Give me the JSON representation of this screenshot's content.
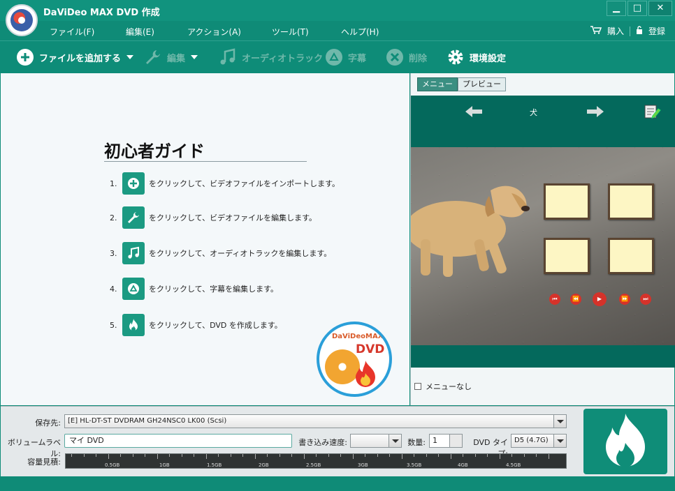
{
  "window": {
    "title": "DaViDeo MAX DVD 作成",
    "minimize": "▁",
    "maximize": "□",
    "close": "✕"
  },
  "menu": {
    "items": [
      "ファイル(F)",
      "編集(E)",
      "アクション(A)",
      "ツール(T)",
      "ヘルプ(H)"
    ],
    "buy": "購入",
    "register": "登録"
  },
  "toolbar": {
    "add_file": "ファイルを追加する",
    "edit": "編集",
    "audio_track": "オーディオトラック",
    "subtitle": "字幕",
    "delete": "削除",
    "settings": "環境設定"
  },
  "guide": {
    "title": "初心者ガイド",
    "steps": [
      {
        "num": "1.",
        "icon": "plus-icon",
        "text": "をクリックして、ビデオファイルをインポートします。"
      },
      {
        "num": "2.",
        "icon": "wrench-icon",
        "text": "をクリックして、ビデオファイルを編集します。"
      },
      {
        "num": "3.",
        "icon": "music-note-icon",
        "text": "をクリックして、オーディオトラックを編集します。"
      },
      {
        "num": "4.",
        "icon": "subtitle-icon",
        "text": "をクリックして、字幕を編集します。"
      },
      {
        "num": "5.",
        "icon": "flame-icon",
        "text": "をクリックして、DVD を作成します。"
      }
    ],
    "badge_brand": "DaViDeoMAX",
    "badge_dvd": "DVD"
  },
  "preview": {
    "tab_menu": "メニュー",
    "tab_preview": "プレビュー",
    "menu_title": "犬",
    "no_menu": "メニューなし"
  },
  "bottom": {
    "save_label": "保存先:",
    "save_value": "[E] HL-DT-ST DVDRAM GH24NSC0 LK00 (Scsi)",
    "volume_label": "ボリュームラベル:",
    "volume_value": "マイ DVD",
    "speed_label": "書き込み速度:",
    "speed_value": "",
    "count_label": "数量:",
    "count_value": "1",
    "dvdtype_label": "DVD タイプ:",
    "dvdtype_value": "D5 (4.7G)",
    "capacity_label": "容量見積:",
    "capacity_ticks": [
      "0.5GB",
      "1GB",
      "1.5GB",
      "2GB",
      "2.5GB",
      "3GB",
      "3.5GB",
      "4GB",
      "4.5GB"
    ]
  },
  "colors": {
    "brand_teal": "#0e8c78",
    "preview_dark": "#04695c",
    "accent_red": "#d5322a"
  }
}
